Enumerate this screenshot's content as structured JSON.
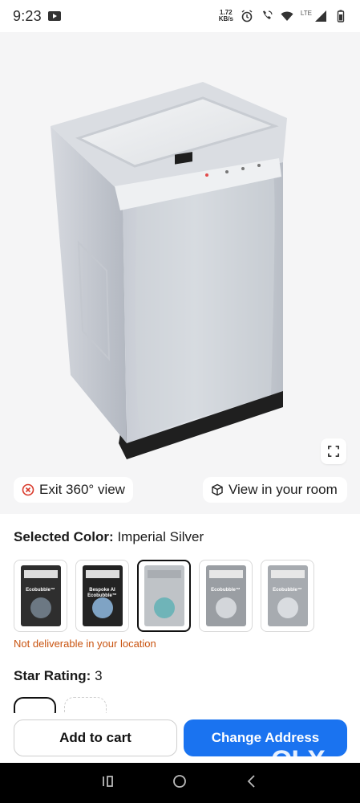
{
  "status_bar": {
    "time": "9:23",
    "net_speed_value": "1.72",
    "net_speed_unit": "KB/s",
    "network_label": "LTE"
  },
  "viewer": {
    "exit_label": "Exit 360° view",
    "room_label": "View in your room"
  },
  "product": {
    "selected_color_label": "Selected Color:",
    "selected_color_value": "Imperial Silver",
    "swatches": [
      {
        "label": "Ecobubble™",
        "box_color": "#2e2e2e"
      },
      {
        "label": "Bespoke AI Ecobubble™",
        "box_color": "#232323"
      },
      {
        "label": "",
        "box_color": "#bfc3c7"
      },
      {
        "label": "Ecobubble™",
        "box_color": "#9a9ea3"
      },
      {
        "label": "Ecobubble™",
        "box_color": "#a7abb0"
      }
    ],
    "delivery_warning": "Not deliverable in your location",
    "star_rating_label": "Star Rating:",
    "star_rating_value": "3"
  },
  "actions": {
    "add_to_cart": "Add to cart",
    "change_address": "Change Address"
  },
  "watermark": "OLX",
  "colors": {
    "primary": "#1a73f0",
    "warning": "#c9530f",
    "viewer_bg": "#f5f5f6"
  }
}
